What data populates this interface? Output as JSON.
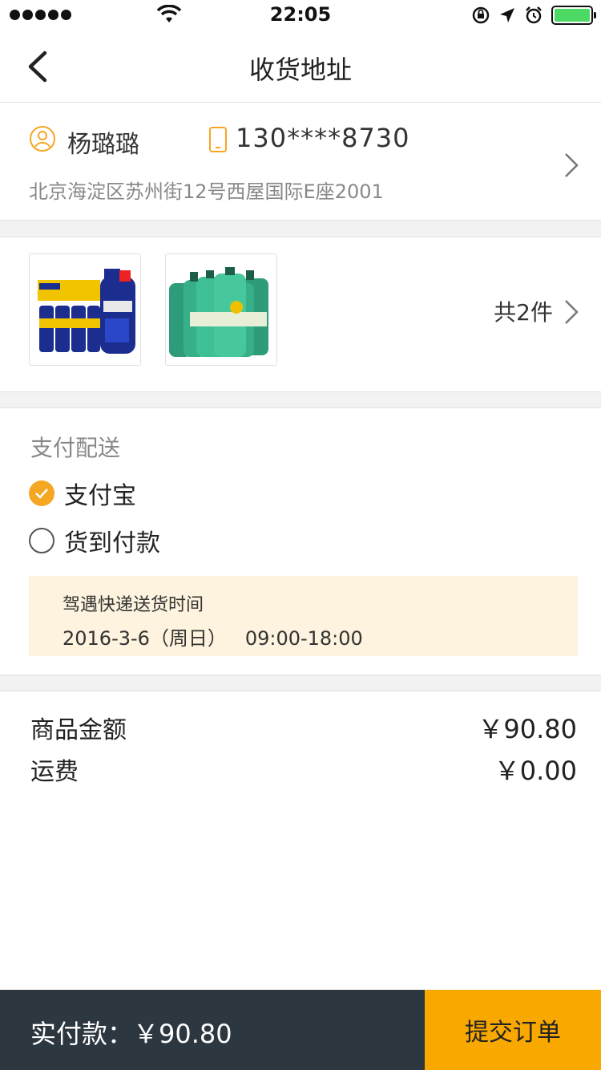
{
  "status_bar": {
    "time": "22:05"
  },
  "nav": {
    "title": "收货地址"
  },
  "address": {
    "name": "杨璐璐",
    "phone": "130****8730",
    "full_address": "北京海淀区苏州街12号西屋国际E座2001"
  },
  "products": {
    "count_label": "共2件",
    "items": [
      {
        "icon": "brake-fluid-product-image"
      },
      {
        "icon": "washer-fluid-product-image"
      }
    ]
  },
  "payment": {
    "title": "支付配送",
    "options": [
      {
        "label": "支付宝",
        "selected": true
      },
      {
        "label": "货到付款",
        "selected": false
      }
    ],
    "delivery": {
      "title": "驾遇快递送货时间",
      "time": "2016-3-6（周日）   09:00-18:00"
    }
  },
  "summary": {
    "rows": [
      {
        "label": "商品金额",
        "value": "￥90.80"
      },
      {
        "label": "运费",
        "value": "￥0.00"
      }
    ]
  },
  "footer": {
    "total_label": "实付款：￥90.80",
    "submit_label": "提交订单"
  },
  "colors": {
    "accent": "#f9a800",
    "footer_dark": "#2d3740",
    "delivery_bg": "#fdf3de"
  }
}
